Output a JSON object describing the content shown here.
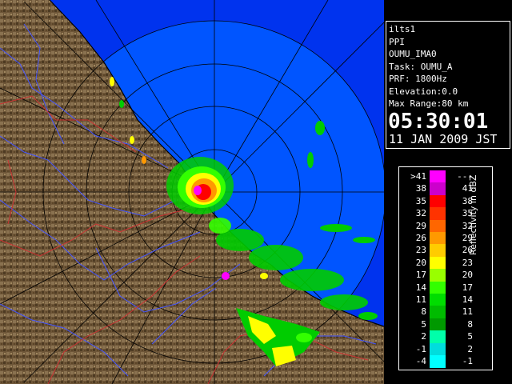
{
  "info": {
    "station": "ilts1",
    "product": "PPI",
    "site": "OUMU_IMA0",
    "task": "Task: OUMU_A",
    "prf": "PRF: 1800Hz",
    "elevation": "Elevation:0.0",
    "max_range": "Max Range:80 km",
    "time": "05:30:01",
    "date": "11 JAN 2009 JST"
  },
  "legend": {
    "title": "Reflectivity in dBZ",
    "rows": [
      {
        "lo": ">41",
        "hi": "---",
        "color": "#ff00ff"
      },
      {
        "lo": "38",
        "hi": "41",
        "color": "#cc00cc"
      },
      {
        "lo": "35",
        "hi": "38",
        "color": "#ff0000"
      },
      {
        "lo": "32",
        "hi": "35",
        "color": "#ff3300"
      },
      {
        "lo": "29",
        "hi": "32",
        "color": "#ff6600"
      },
      {
        "lo": "26",
        "hi": "29",
        "color": "#ff9900"
      },
      {
        "lo": "23",
        "hi": "26",
        "color": "#ffcc00"
      },
      {
        "lo": "20",
        "hi": "23",
        "color": "#ffff00"
      },
      {
        "lo": "17",
        "hi": "20",
        "color": "#99ff00"
      },
      {
        "lo": "14",
        "hi": "17",
        "color": "#33ff00"
      },
      {
        "lo": "11",
        "hi": "14",
        "color": "#00dd00"
      },
      {
        "lo": "8",
        "hi": "11",
        "color": "#00bb00"
      },
      {
        "lo": "5",
        "hi": "8",
        "color": "#009900"
      },
      {
        "lo": "2",
        "hi": "5",
        "color": "#00ffaa"
      },
      {
        "lo": "-1",
        "hi": "2",
        "color": "#00dddd"
      },
      {
        "lo": "-4",
        "hi": "-1",
        "color": "#00ffff"
      }
    ]
  },
  "colors": {
    "sea": "#0055ff",
    "sea_outer": "#0033ee",
    "land": "#7a6040",
    "ring": "#000000",
    "river": "#4455ff",
    "border": "#cc3333"
  }
}
